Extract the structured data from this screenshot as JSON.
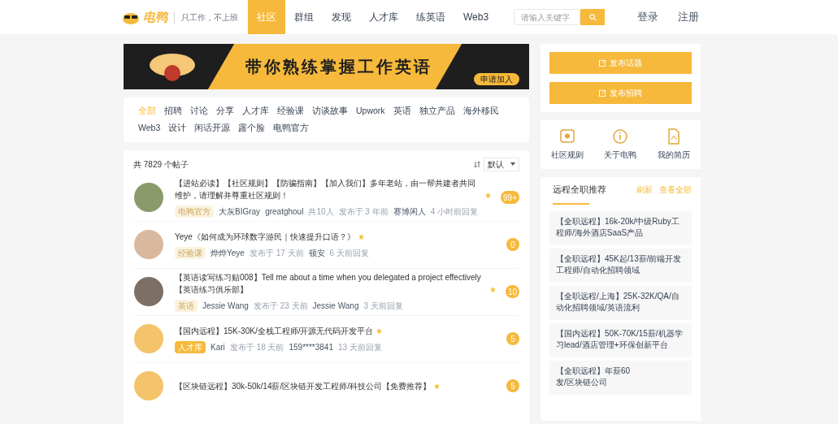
{
  "header": {
    "logo": "电鸭",
    "slogan": "只工作，不上班",
    "nav": [
      {
        "label": "社区",
        "selected": true
      },
      {
        "label": "群组",
        "selected": false
      },
      {
        "label": "发现",
        "selected": false
      },
      {
        "label": "人才库",
        "selected": false
      },
      {
        "label": "练英语",
        "selected": false
      },
      {
        "label": "Web3",
        "selected": false
      }
    ],
    "search": {
      "placeholder": "请输入关键字"
    },
    "login": "登录",
    "register": "注册"
  },
  "banner": {
    "headline": "带你熟练掌握工作英语",
    "button": "申请加入"
  },
  "categories": [
    {
      "label": "全部",
      "selected": true
    },
    {
      "label": "招聘",
      "selected": false
    },
    {
      "label": "讨论",
      "selected": false
    },
    {
      "label": "分享",
      "selected": false
    },
    {
      "label": "人才库",
      "selected": false
    },
    {
      "label": "经验课",
      "selected": false
    },
    {
      "label": "访谈故事",
      "selected": false
    },
    {
      "label": "Upwork",
      "selected": false
    },
    {
      "label": "英语",
      "selected": false
    },
    {
      "label": "独立产品",
      "selected": false
    },
    {
      "label": "海外移民",
      "selected": false
    },
    {
      "label": "Web3",
      "selected": false
    },
    {
      "label": "设计",
      "selected": false
    },
    {
      "label": "闲话开源",
      "selected": false
    },
    {
      "label": "露个脸",
      "selected": false
    },
    {
      "label": "电鸭官方",
      "selected": false
    }
  ],
  "posts_header": {
    "count": "共 7829 个帖子",
    "sort": "默认"
  },
  "posts": [
    {
      "title": "【进站必读】【社区规则】【防骗指南】【加入我们】多年老站，由一帮共建者共同维护，请理解并尊重社区规则！",
      "category": "电鸭官方",
      "highlighted": false,
      "author": "大灰BIGray",
      "coauthor": "greatghoul",
      "participants": "共10人",
      "posted": "发布于 3 年前",
      "replier": "赛博闲人",
      "replied": "4 小时前回复",
      "count": "99+"
    },
    {
      "title": "Yeye《如何成为环球数字游民｜快速提升口语？》",
      "category": "经验课",
      "highlighted": false,
      "author": "烨烨Yeye",
      "posted": "发布于 17 天前",
      "replier": "顿安",
      "replied": "6 天前回复",
      "count": "0"
    },
    {
      "title": "【英语读写练习贴008】Tell me about a time when you delegated a project effectively【英语练习俱乐部】",
      "category": "英语",
      "highlighted": false,
      "author": "Jessie Wang",
      "posted": "发布于 23 天前",
      "replier": "Jessie Wang",
      "replied": "3 天前回复",
      "count": "10"
    },
    {
      "title": "【国内远程】15K-30K/全栈工程师/开源无代码开发平台",
      "category": "人才库",
      "highlighted": true,
      "author": "Kari",
      "posted": "发布于 18 天前",
      "replier": "159****3841",
      "replied": "13 天前回复",
      "count": "5"
    },
    {
      "title": "【区块链远程】30k-50k/14薪/区块链开发工程师/科技公司【免费推荐】",
      "count": "5"
    }
  ],
  "actions": [
    "发布话题",
    "发布招聘"
  ],
  "shortcuts": [
    {
      "kind": "rules",
      "label": "社区规则"
    },
    {
      "kind": "about",
      "label": "关于电鸭"
    },
    {
      "kind": "resume",
      "label": "我的简历"
    }
  ],
  "recommend": {
    "title": "远程全职推荐",
    "refresh": "刷新",
    "view_all": "查看全部",
    "items": [
      {
        "text": "【全职远程】16k-20k/中级Ruby工程师/海外酒店SaaS产品"
      },
      {
        "text": "【全职远程】45K起/13薪/前端开发工程师/自动化招聘领域"
      },
      {
        "text": "【全职远程/上海】25K-32K/QA/自动化招聘领域/英语流利"
      },
      {
        "text": "【国内远程】50K-70K/15薪/机器学习lead/酒店管理+环保创新平台"
      },
      {
        "text": "【全职远程】年薪60",
        "text_end": "发/区块链公司"
      }
    ]
  }
}
